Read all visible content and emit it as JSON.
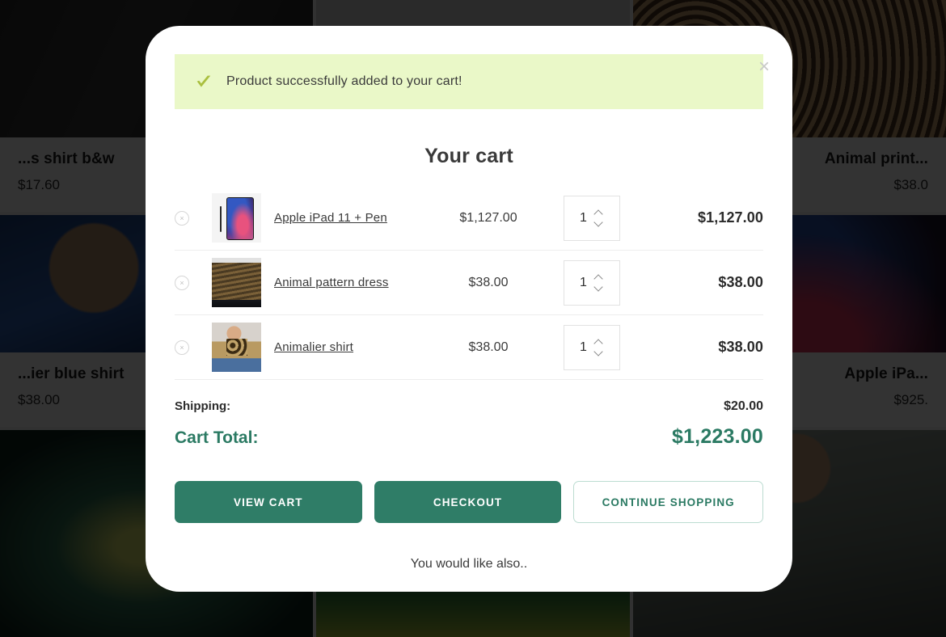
{
  "background": {
    "products": [
      {
        "title": "...s shirt b&w",
        "price": "$17.60",
        "align": "left",
        "photo": "ph-stripe-dark"
      },
      {
        "title": "",
        "price": "",
        "align": "left",
        "photo": "ph-jeans"
      },
      {
        "title": "Animal print...",
        "price": "$38.0",
        "align": "right",
        "photo": "ph-leopard"
      },
      {
        "title": "...ier blue shirt",
        "price": "$38.00",
        "align": "left",
        "photo": "ph-model-blue"
      },
      {
        "title": "",
        "price": "",
        "align": "left",
        "photo": "ph-tablet-dark"
      },
      {
        "title": "Apple iPa...",
        "price": "$925.",
        "align": "right",
        "photo": "ph-ipad-screen"
      },
      {
        "title": "",
        "price": "",
        "align": "left",
        "photo": "ph-phone-green"
      },
      {
        "title": "",
        "price": "",
        "align": "left",
        "photo": "ph-phone-grad"
      },
      {
        "title": "",
        "price": "",
        "align": "left",
        "photo": "ph-man-shirt"
      }
    ]
  },
  "modal": {
    "close_label": "×",
    "banner": {
      "icon": "check-icon",
      "message": "Product successfully added to your cart!",
      "bg_color": "#eaf8c8",
      "icon_color": "#a9bf3e"
    },
    "title": "Your cart",
    "items": [
      {
        "remove_label": "×",
        "thumb": "th-ipad",
        "name": "Apple iPad 11 + Pen",
        "price": "$1,127.00",
        "qty": "1",
        "subtotal": "$1,127.00"
      },
      {
        "remove_label": "×",
        "thumb": "th-dress",
        "name": "Animal pattern dress",
        "price": "$38.00",
        "qty": "1",
        "subtotal": "$38.00"
      },
      {
        "remove_label": "×",
        "thumb": "th-shirt",
        "name": "Animalier shirt",
        "price": "$38.00",
        "qty": "1",
        "subtotal": "$38.00"
      }
    ],
    "totals": {
      "shipping_label": "Shipping:",
      "shipping_value": "$20.00",
      "cart_total_label": "Cart Total:",
      "cart_total_value": "$1,223.00",
      "accent_color": "#2b7a63"
    },
    "actions": {
      "view_cart": "VIEW CART",
      "checkout": "CHECKOUT",
      "continue_shopping": "CONTINUE SHOPPING"
    },
    "suggestion_text": "You would like also.."
  }
}
